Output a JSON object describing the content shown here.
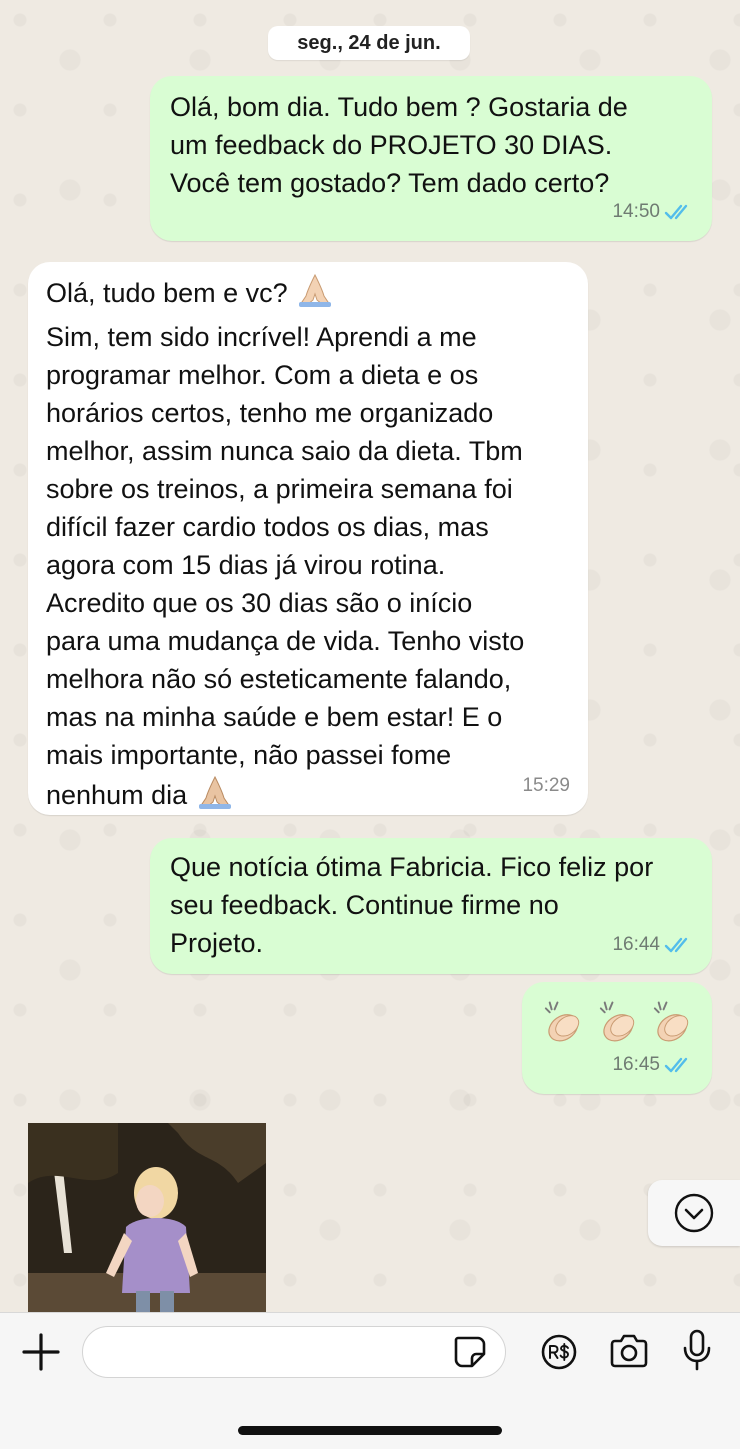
{
  "date_chip": "seg., 24 de jun.",
  "messages": [
    {
      "direction": "outgoing",
      "text": "Olá, bom dia. Tudo bem ? Gostaria de\num feedback do PROJETO 30 DIAS.\nVocê tem gostado? Tem dado certo?",
      "time": "14:50",
      "status": "read"
    },
    {
      "direction": "incoming",
      "text_first_line": "Olá, tudo bem e vc?",
      "text": "Sim, tem sido incrível! Aprendi a me\nprogramar melhor. Com a dieta e os\nhorários certos, tenho me organizado\nmelhor, assim nunca saio da dieta. Tbm\nsobre os treinos, a primeira semana foi\ndifícil fazer cardio todos os dias, mas\nagora com 15 dias já virou rotina.\nAcredito que os 30 dias são o início\npara uma mudança de vida. Tenho visto\nmelhora não só esteticamente falando,\nmas na minha saúde e bem estar! E o\nmais importante, não passei fome",
      "text_last_line": "nenhum dia",
      "time": "15:29"
    },
    {
      "direction": "outgoing",
      "text": "Que notícia ótima Fabricia. Fico feliz por\nseu feedback. Continue firme no\nProjeto.",
      "time": "16:44",
      "status": "read"
    },
    {
      "direction": "outgoing",
      "emoji": "clapping-hands x3",
      "time": "16:45",
      "status": "read"
    }
  ],
  "media": {
    "type": "gif",
    "subject": "toddler dancing"
  },
  "composer": {
    "placeholder": "",
    "icons": [
      "plus-icon",
      "sticker-icon",
      "payment-icon",
      "camera-icon",
      "microphone-icon"
    ]
  },
  "colors": {
    "outgoing_bubble": "#d9fdd3",
    "incoming_bubble": "#ffffff",
    "wallpaper": "#efeae2",
    "read_ticks": "#53bdeb"
  }
}
